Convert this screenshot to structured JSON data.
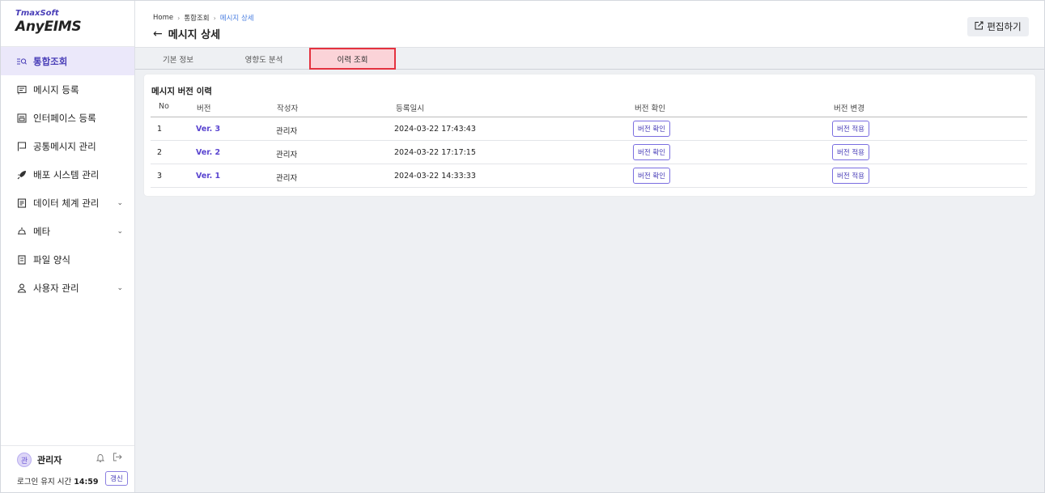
{
  "app": {
    "logo_top": "TmaxSoft",
    "logo_main": "AnyEIMS"
  },
  "sidebar": {
    "items": [
      {
        "label": "통합조회",
        "icon": "search-list-icon",
        "active": true
      },
      {
        "label": "메시지 등록",
        "icon": "message-icon"
      },
      {
        "label": "인터페이스 등록",
        "icon": "interface-icon"
      },
      {
        "label": "공통메시지 관리",
        "icon": "flag-icon"
      },
      {
        "label": "배포 시스템 관리",
        "icon": "rocket-icon"
      },
      {
        "label": "데이터 체계 관리",
        "icon": "document-icon",
        "expandable": true
      },
      {
        "label": "메타",
        "icon": "meta-icon",
        "expandable": true
      },
      {
        "label": "파일 양식",
        "icon": "file-icon"
      },
      {
        "label": "사용자 관리",
        "icon": "user-icon",
        "expandable": true
      }
    ],
    "footer": {
      "avatar_text": "관",
      "user_name": "관리자",
      "session_label": "로그인 유지 시간",
      "session_time": "14:59",
      "refresh_label": "갱신"
    }
  },
  "header": {
    "breadcrumb": [
      "Home",
      "통합조회",
      "메시지 상세"
    ],
    "title": "메시지 상세",
    "edit_label": "편집하기"
  },
  "tabs": [
    {
      "label": "기본 정보"
    },
    {
      "label": "영향도 분석"
    },
    {
      "label": "이력 조회",
      "active": true
    }
  ],
  "card": {
    "title": "메시지 버전 이력",
    "columns": [
      "No",
      "버전",
      "작성자",
      "등록일시",
      "버전 확인",
      "버전 변경"
    ],
    "rows": [
      {
        "no": "1",
        "version": "Ver. 3",
        "author": "관리자",
        "registered": "2024-03-22 17:43:43",
        "check": "버전 확인",
        "apply": "버전 적용"
      },
      {
        "no": "2",
        "version": "Ver. 2",
        "author": "관리자",
        "registered": "2024-03-22 17:17:15",
        "check": "버전 확인",
        "apply": "버전 적용"
      },
      {
        "no": "3",
        "version": "Ver. 1",
        "author": "관리자",
        "registered": "2024-03-22 14:33:33",
        "check": "버전 확인",
        "apply": "버전 적용"
      }
    ]
  },
  "colors": {
    "accent": "#4a3fb8",
    "active_tab_bg": "#fbd3d8",
    "active_tab_border": "#e4323f"
  }
}
